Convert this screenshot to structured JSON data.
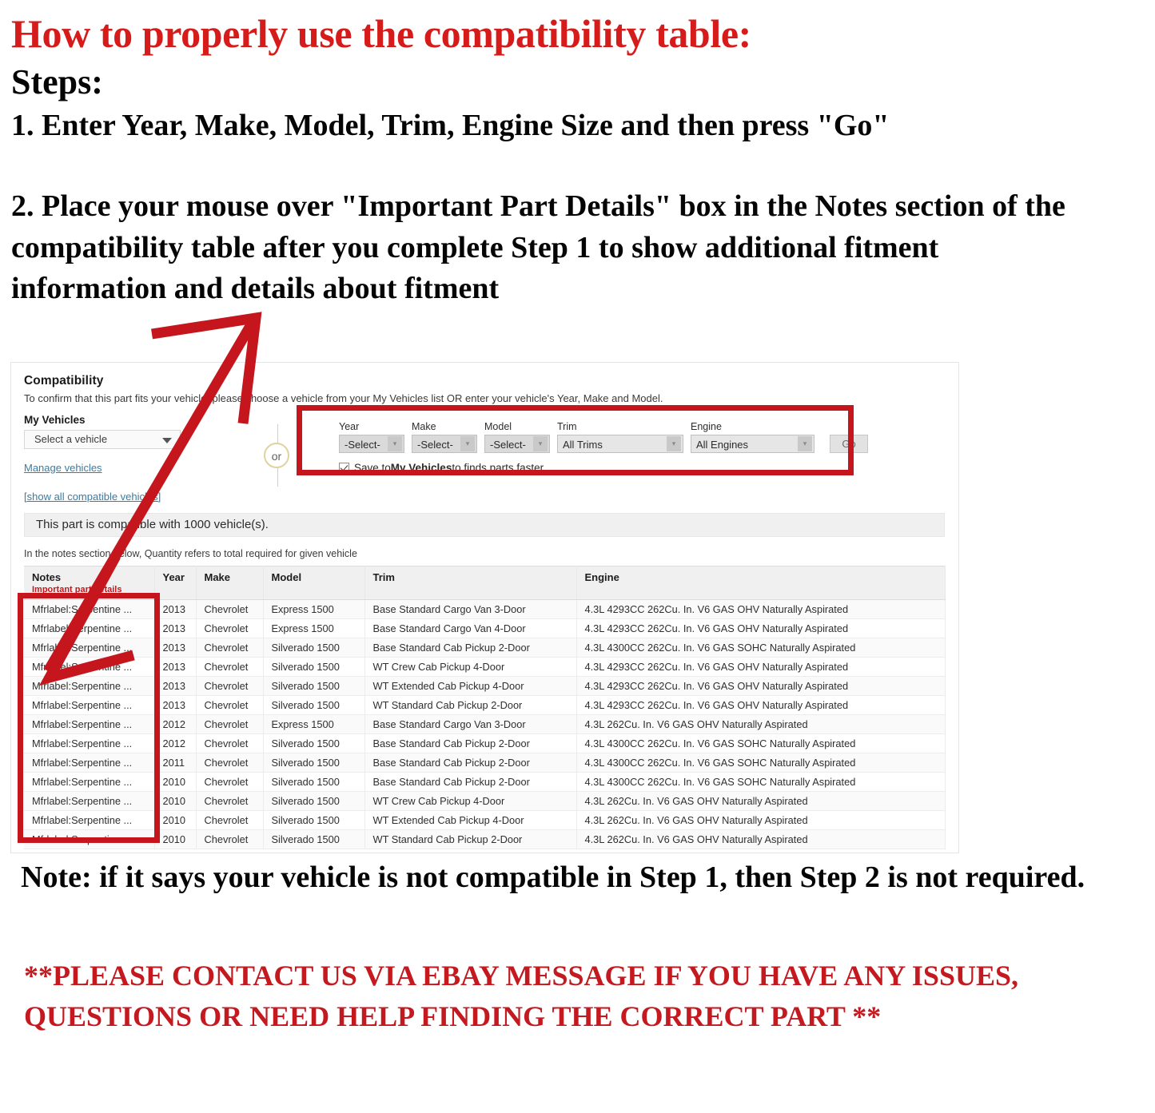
{
  "instructions": {
    "heading": "How to properly use the compatibility table:",
    "steps_label": "Steps:",
    "step1": "1. Enter Year, Make, Model, Trim, Engine Size and then press \"Go\"",
    "step2": "2. Place your mouse over \"Important Part Details\" box in the Notes section of the compatibility table after you complete Step 1 to show additional fitment information and details about fitment"
  },
  "compatibility": {
    "title": "Compatibility",
    "subtitle": "To confirm that this part fits your vehicle, please choose a vehicle from your My Vehicles list OR enter your vehicle's Year, Make and Model.",
    "my_vehicles_label": "My Vehicles",
    "vehicle_select_value": "Select a vehicle",
    "manage_vehicles_link": "Manage vehicles",
    "show_all_link": "[show all compatible vehicles]",
    "or_label": "or",
    "finder": {
      "year_label": "Year",
      "year_value": "-Select-",
      "make_label": "Make",
      "make_value": "-Select-",
      "model_label": "Model",
      "model_value": "-Select-",
      "trim_label": "Trim",
      "trim_value": "All Trims",
      "engine_label": "Engine",
      "engine_value": "All Engines",
      "go_label": "Go",
      "save_prefix": "Save to ",
      "save_bold": "My Vehicles",
      "save_suffix": " to finds parts faster"
    },
    "banner": "This part is compatible with 1000 vehicle(s).",
    "notes_hint": "In the notes section below, Quantity refers to total required for given vehicle",
    "table": {
      "headers": {
        "notes": "Notes",
        "notes_sub": "Important part details",
        "year": "Year",
        "make": "Make",
        "model": "Model",
        "trim": "Trim",
        "engine": "Engine"
      },
      "rows": [
        {
          "notes": "Mfrlabel:Serpentine ...",
          "year": "2013",
          "make": "Chevrolet",
          "model": "Express 1500",
          "trim": "Base Standard Cargo Van 3-Door",
          "engine": "4.3L 4293CC 262Cu. In. V6 GAS OHV Naturally Aspirated"
        },
        {
          "notes": "Mfrlabel:Serpentine ...",
          "year": "2013",
          "make": "Chevrolet",
          "model": "Express 1500",
          "trim": "Base Standard Cargo Van 4-Door",
          "engine": "4.3L 4293CC 262Cu. In. V6 GAS OHV Naturally Aspirated"
        },
        {
          "notes": "Mfrlabel:Serpentine ...",
          "year": "2013",
          "make": "Chevrolet",
          "model": "Silverado 1500",
          "trim": "Base Standard Cab Pickup 2-Door",
          "engine": "4.3L 4300CC 262Cu. In. V6 GAS SOHC Naturally Aspirated"
        },
        {
          "notes": "Mfrlabel:Serpentine ...",
          "year": "2013",
          "make": "Chevrolet",
          "model": "Silverado 1500",
          "trim": "WT Crew Cab Pickup 4-Door",
          "engine": "4.3L 4293CC 262Cu. In. V6 GAS OHV Naturally Aspirated"
        },
        {
          "notes": "Mfrlabel:Serpentine ...",
          "year": "2013",
          "make": "Chevrolet",
          "model": "Silverado 1500",
          "trim": "WT Extended Cab Pickup 4-Door",
          "engine": "4.3L 4293CC 262Cu. In. V6 GAS OHV Naturally Aspirated"
        },
        {
          "notes": "Mfrlabel:Serpentine ...",
          "year": "2013",
          "make": "Chevrolet",
          "model": "Silverado 1500",
          "trim": "WT Standard Cab Pickup 2-Door",
          "engine": "4.3L 4293CC 262Cu. In. V6 GAS OHV Naturally Aspirated"
        },
        {
          "notes": "Mfrlabel:Serpentine ...",
          "year": "2012",
          "make": "Chevrolet",
          "model": "Express 1500",
          "trim": "Base Standard Cargo Van 3-Door",
          "engine": "4.3L 262Cu. In. V6 GAS OHV Naturally Aspirated"
        },
        {
          "notes": "Mfrlabel:Serpentine ...",
          "year": "2012",
          "make": "Chevrolet",
          "model": "Silverado 1500",
          "trim": "Base Standard Cab Pickup 2-Door",
          "engine": "4.3L 4300CC 262Cu. In. V6 GAS SOHC Naturally Aspirated"
        },
        {
          "notes": "Mfrlabel:Serpentine ...",
          "year": "2011",
          "make": "Chevrolet",
          "model": "Silverado 1500",
          "trim": "Base Standard Cab Pickup 2-Door",
          "engine": "4.3L 4300CC 262Cu. In. V6 GAS SOHC Naturally Aspirated"
        },
        {
          "notes": "Mfrlabel:Serpentine ...",
          "year": "2010",
          "make": "Chevrolet",
          "model": "Silverado 1500",
          "trim": "Base Standard Cab Pickup 2-Door",
          "engine": "4.3L 4300CC 262Cu. In. V6 GAS SOHC Naturally Aspirated"
        },
        {
          "notes": "Mfrlabel:Serpentine ...",
          "year": "2010",
          "make": "Chevrolet",
          "model": "Silverado 1500",
          "trim": "WT Crew Cab Pickup 4-Door",
          "engine": "4.3L 262Cu. In. V6 GAS OHV Naturally Aspirated"
        },
        {
          "notes": "Mfrlabel:Serpentine ...",
          "year": "2010",
          "make": "Chevrolet",
          "model": "Silverado 1500",
          "trim": "WT Extended Cab Pickup 4-Door",
          "engine": "4.3L 262Cu. In. V6 GAS OHV Naturally Aspirated"
        },
        {
          "notes": "Mfrlabel:Serpentine ...",
          "year": "2010",
          "make": "Chevrolet",
          "model": "Silverado 1500",
          "trim": "WT Standard Cab Pickup 2-Door",
          "engine": "4.3L 262Cu. In. V6 GAS OHV Naturally Aspirated"
        }
      ]
    }
  },
  "footer": {
    "note": "Note: if it says your vehicle is not compatible in Step 1, then Step 2 is not required.",
    "contact": "**PLEASE CONTACT US VIA EBAY MESSAGE IF YOU HAVE ANY ISSUES, QUESTIONS OR NEED HELP FINDING THE CORRECT PART **"
  },
  "colors": {
    "heading_red": "#d61b1b",
    "box_red": "#c4161c",
    "link_blue": "#3a7ca0"
  }
}
